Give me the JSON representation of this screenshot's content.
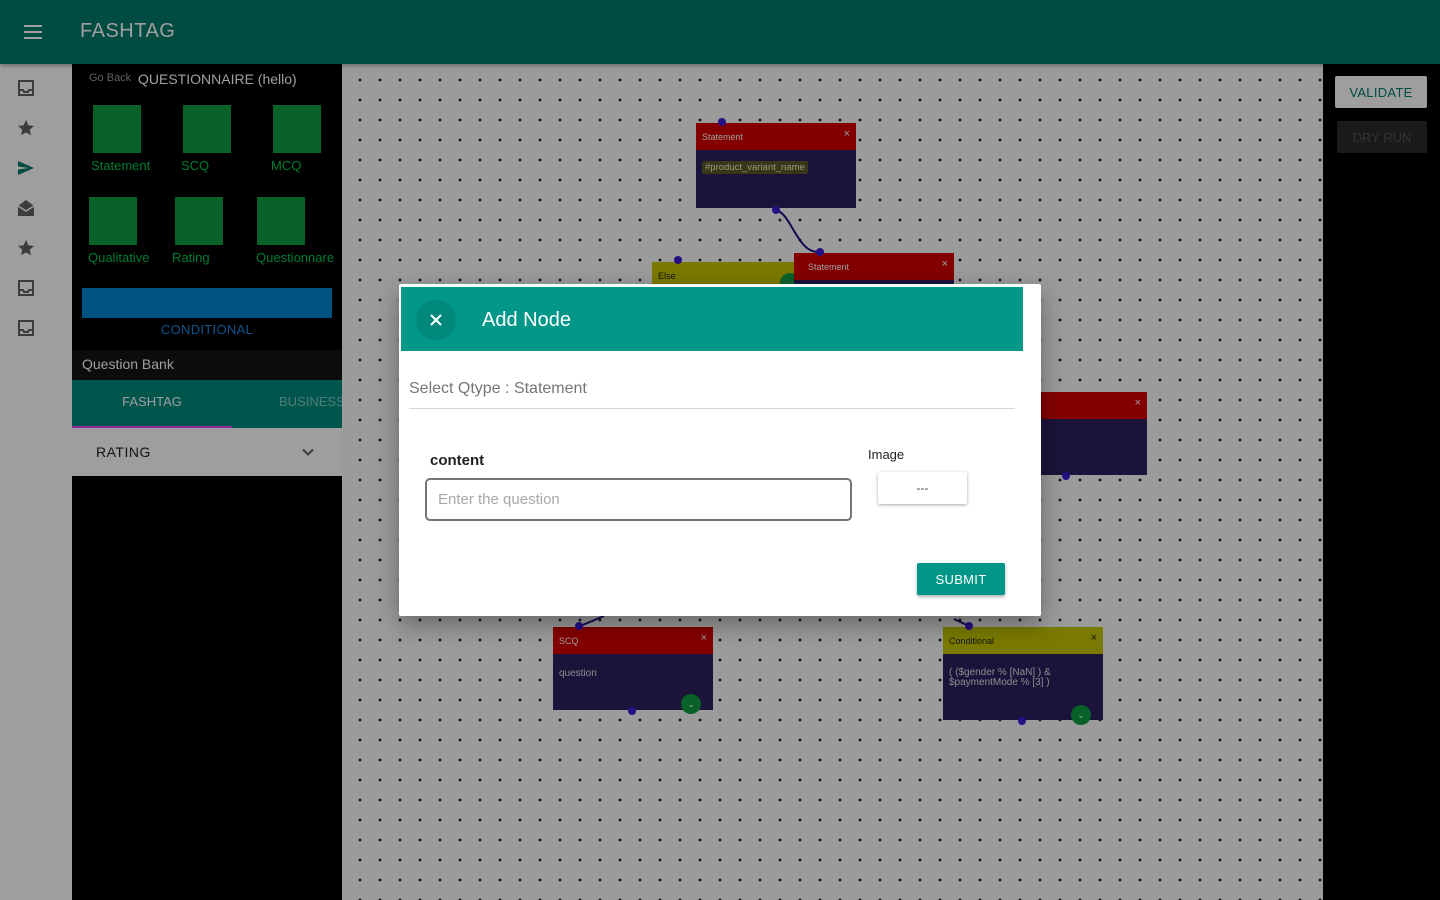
{
  "app": {
    "title": "FASHTAG"
  },
  "rail": {
    "icons": [
      "inbox-icon",
      "star-icon",
      "send-icon",
      "drafts-icon",
      "star-icon",
      "inbox-icon",
      "inbox-icon"
    ],
    "active_color": "#00796b"
  },
  "panel": {
    "go_back": "Go Back",
    "title": "QUESTIONNAIRE (hello)",
    "node_types": [
      "Statement",
      "SCQ",
      "MCQ",
      "Qualitative",
      "Rating",
      "Questionnare"
    ],
    "conditional_label": "CONDITIONAL",
    "question_bank_label": "Question Bank",
    "tabs": [
      "FASHTAG",
      "BUSINESS"
    ],
    "accordion_label": "RATING"
  },
  "canvas": {
    "nodes": {
      "statement1": {
        "title": "Statement",
        "close": "×",
        "chip": "#product_variant_name"
      },
      "else_node": {
        "title": "Else"
      },
      "statement2": {
        "title": "Statement",
        "close": "×"
      },
      "right_node": {
        "close": "×"
      },
      "scq": {
        "title": "SCQ",
        "close": "×",
        "text": "question"
      },
      "conditional": {
        "title": "Conditional",
        "close": "×",
        "text": "( ($gender % [NaN] ) & $paymentMode % [3] )"
      }
    }
  },
  "actions": {
    "validate": "VALIDATE",
    "dry_run": "DRY RUN"
  },
  "dialog": {
    "title": "Add Node",
    "qtype": "Select Qtype : Statement",
    "content_label": "content",
    "content_placeholder": "Enter the question",
    "image_label": "Image",
    "image_value": "---",
    "submit": "SUBMIT"
  },
  "colors": {
    "primary": "#00796b",
    "accent": "#009688",
    "node_red": "#d50000",
    "node_yellow": "#c6c600",
    "node_body": "#2d1f5e",
    "tile_green": "#0f9d45"
  }
}
